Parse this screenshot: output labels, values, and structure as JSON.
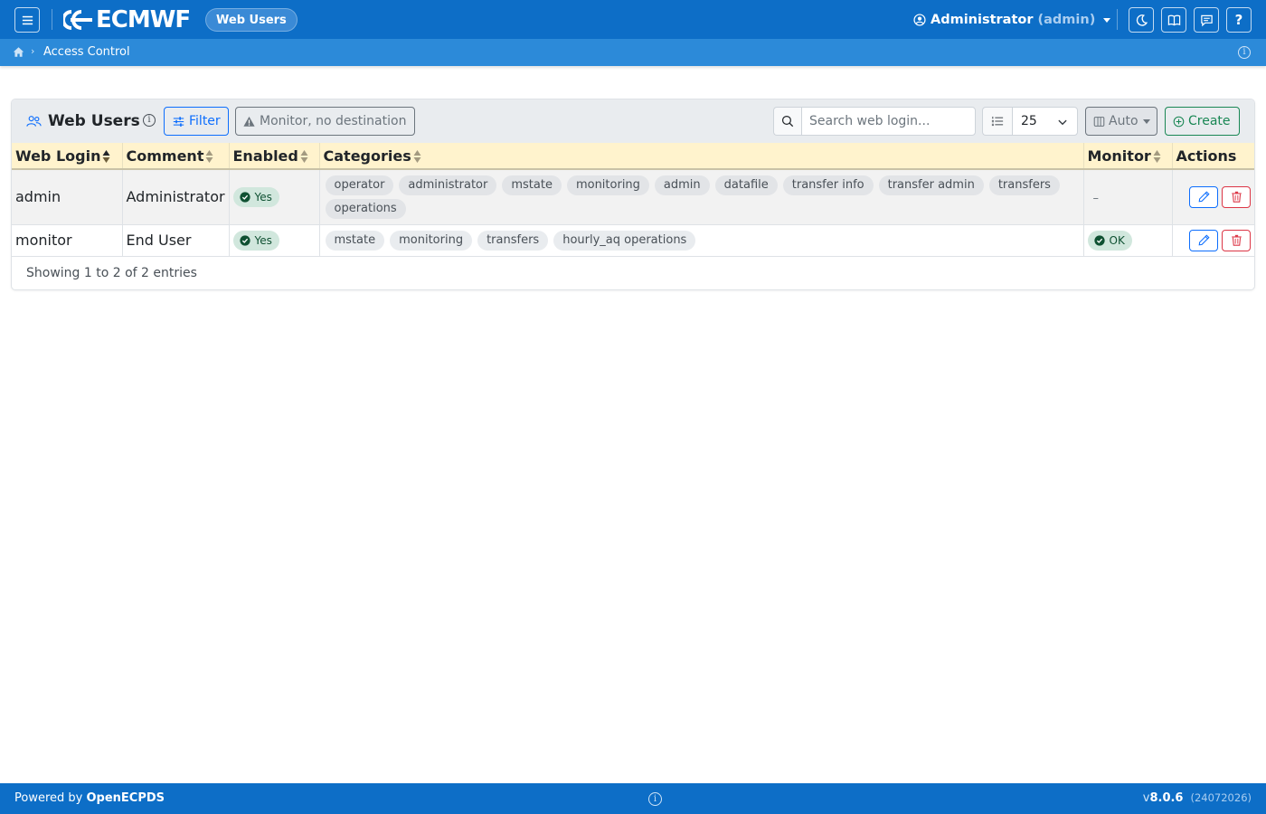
{
  "navbar": {
    "brand": "ECMWF",
    "app_pill": "Web Users",
    "user_name": "Administrator",
    "user_login": "(admin)",
    "icons": [
      "menu-icon",
      "moon-icon",
      "book-icon",
      "chat-icon",
      "help-icon"
    ],
    "help_label": "?"
  },
  "breadcrumb": {
    "current": "Access Control"
  },
  "card": {
    "title": "Web Users",
    "filter_label": "Filter",
    "monitor_label": "Monitor, no destination",
    "search_placeholder": "Search web login...",
    "page_length": "25",
    "columns_label": "Auto",
    "create_label": "Create"
  },
  "table": {
    "columns": [
      "Web Login",
      "Comment",
      "Enabled",
      "Categories",
      "Monitor",
      "Actions"
    ],
    "rows": [
      {
        "login": "admin",
        "comment": "Administrator",
        "enabled": "Yes",
        "categories": [
          "operator",
          "administrator",
          "mstate",
          "monitoring",
          "admin",
          "datafile",
          "transfer info",
          "transfer admin",
          "transfers",
          "operations"
        ],
        "monitor": "–"
      },
      {
        "login": "monitor",
        "comment": "End User",
        "enabled": "Yes",
        "categories": [
          "mstate",
          "monitoring",
          "transfers",
          "hourly_aq operations"
        ],
        "monitor": "OK"
      }
    ],
    "info": "Showing 1 to 2 of 2 entries"
  },
  "footer": {
    "powered_prefix": "Powered by",
    "powered_name": "OpenECPDS",
    "version_prefix": "v",
    "version": "8.0.6",
    "build": "(24072026)"
  },
  "colors": {
    "navbar": "#0d6ec7",
    "breadcrumb_bar": "#2c8ad9",
    "table_header": "#fff3cd",
    "success_badge": "#d1e7dd",
    "primary": "#0d6efd",
    "danger": "#dc3545",
    "create": "#198754"
  }
}
